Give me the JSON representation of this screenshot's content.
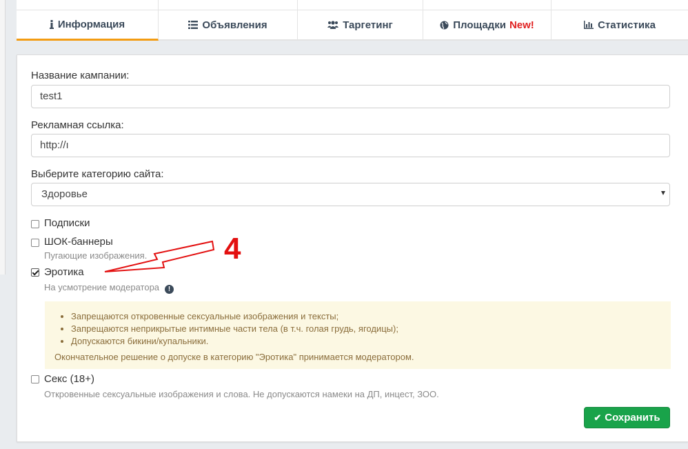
{
  "tabs": [
    {
      "label": "Информация",
      "icon": "info-icon"
    },
    {
      "label": "Объявления",
      "icon": "list-icon"
    },
    {
      "label": "Таргетинг",
      "icon": "users-icon"
    },
    {
      "label": "Площадки",
      "badge": "New!",
      "icon": "globe-icon"
    },
    {
      "label": "Статистика",
      "icon": "bar-chart-icon"
    }
  ],
  "form": {
    "campaign_name_label": "Название кампании:",
    "campaign_name_value": "test1",
    "ad_link_label": "Рекламная ссылка:",
    "ad_link_value": "http://ı",
    "category_label": "Выберите категорию сайта:",
    "category_value": "Здоровье",
    "options": [
      {
        "label": "Подписки",
        "checked": false
      },
      {
        "label": "ШОК-баннеры",
        "hint": "Пугающие изображения.",
        "checked": false
      },
      {
        "label": "Эротика",
        "hint": "На усмотрение модератора",
        "checked": true
      },
      {
        "label": "Секс (18+)",
        "hint": "Откровенные сексуальные изображения и слова. Не допускаются намеки на ДП, инцест, ЗОО.",
        "checked": false
      }
    ],
    "warning": {
      "rules": [
        "Запрещаются откровенные сексуальные изображения и тексты;",
        "Запрещаются неприкрытые интимные части тела (в т.ч. голая грудь, ягодицы);",
        "Допускаются бикини/купальники."
      ],
      "final_note": "Окончательное решение о допуске в категорию \"Эротика\" принимается модератором."
    },
    "save_label": "Сохранить"
  },
  "annotation": {
    "number": "4"
  },
  "colors": {
    "active_tab": "#f39c12",
    "new_badge": "#e02020",
    "save_button": "#19a34a",
    "annotation": "#e31010"
  }
}
